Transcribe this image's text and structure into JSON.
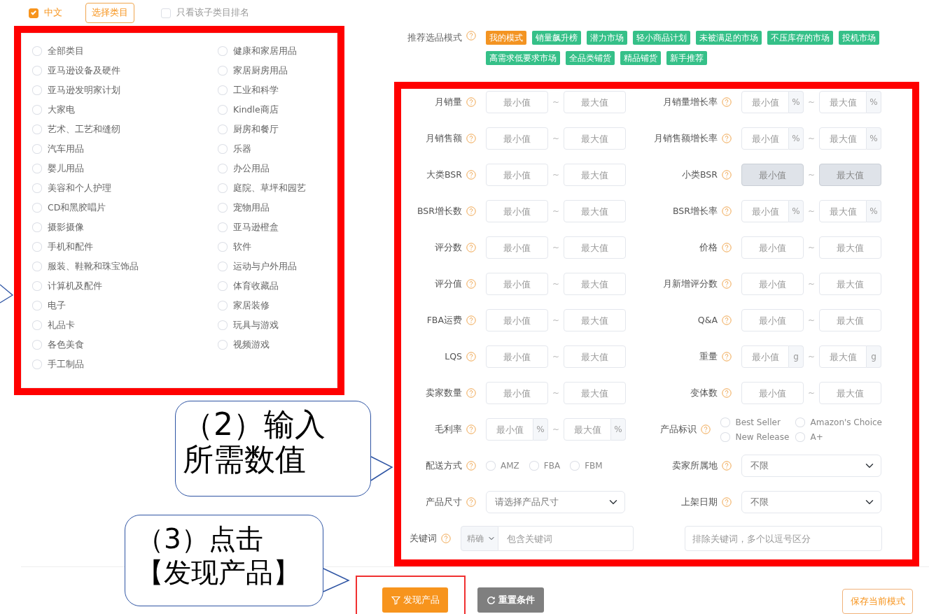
{
  "top_bar": {
    "language": {
      "label": "中文",
      "checked": true
    },
    "category_button": "选择类目",
    "subcategory_only": {
      "label": "只看该子类目排名",
      "checked": false
    }
  },
  "categories": [
    {
      "label": "全部类目",
      "checked": false
    },
    {
      "label": "亚马逊设备及硬件",
      "checked": false
    },
    {
      "label": "亚马逊发明家计划",
      "checked": false
    },
    {
      "label": "大家电",
      "checked": false
    },
    {
      "label": "艺术、工艺和缝纫",
      "checked": false
    },
    {
      "label": "汽车用品",
      "checked": false
    },
    {
      "label": "婴儿用品",
      "checked": false
    },
    {
      "label": "美容和个人护理",
      "checked": false
    },
    {
      "label": "CD和黑胶唱片",
      "checked": false
    },
    {
      "label": "摄影摄像",
      "checked": false
    },
    {
      "label": "手机和配件",
      "checked": false
    },
    {
      "label": "服装、鞋靴和珠宝饰品",
      "checked": false
    },
    {
      "label": "计算机及配件",
      "checked": false
    },
    {
      "label": "电子",
      "checked": false
    },
    {
      "label": "礼品卡",
      "checked": false
    },
    {
      "label": "各色美食",
      "checked": false
    },
    {
      "label": "手工制品",
      "checked": false
    },
    {
      "label": "健康和家居用品",
      "checked": false
    },
    {
      "label": "家居厨房用品",
      "checked": false
    },
    {
      "label": "工业和科学",
      "checked": false
    },
    {
      "label": "Kindle商店",
      "checked": false
    },
    {
      "label": "厨房和餐厅",
      "checked": false
    },
    {
      "label": "乐器",
      "checked": false
    },
    {
      "label": "办公用品",
      "checked": false
    },
    {
      "label": "庭院、草坪和园艺",
      "checked": false
    },
    {
      "label": "宠物用品",
      "checked": false
    },
    {
      "label": "亚马逊橙盒",
      "checked": false
    },
    {
      "label": "软件",
      "checked": false
    },
    {
      "label": "运动与户外用品",
      "checked": false
    },
    {
      "label": "体育收藏品",
      "checked": false
    },
    {
      "label": "家居装修",
      "checked": false
    },
    {
      "label": "玩具与游戏",
      "checked": false
    },
    {
      "label": "视频游戏",
      "checked": false
    }
  ],
  "modes": {
    "label": "推荐选品模式",
    "items": [
      {
        "label": "我的模式",
        "selected": true
      },
      {
        "label": "销量飙升榜",
        "selected": false
      },
      {
        "label": "潜力市场",
        "selected": false
      },
      {
        "label": "轻小商品计划",
        "selected": false
      },
      {
        "label": "未被满足的市场",
        "selected": false
      },
      {
        "label": "不压库存的市场",
        "selected": false
      },
      {
        "label": "投机市场",
        "selected": false
      },
      {
        "label": "高需求低要求市场",
        "selected": false
      },
      {
        "label": "全品类铺货",
        "selected": false
      },
      {
        "label": "精品铺货",
        "selected": false
      },
      {
        "label": "新手推荐",
        "selected": false
      }
    ]
  },
  "filters": [
    {
      "kind": "range",
      "label": "月销量",
      "min_placeholder": "最小值",
      "separator": "~",
      "max_placeholder": "最大值",
      "disabled": false
    },
    {
      "kind": "range",
      "label": "月销量增长率",
      "min_placeholder": "最小值",
      "min_unit": "%",
      "separator": "~",
      "max_placeholder": "最大值",
      "max_unit": "%",
      "disabled": false
    },
    {
      "kind": "range",
      "label": "月销售额",
      "min_placeholder": "最小值",
      "separator": "~",
      "max_placeholder": "最大值",
      "disabled": false
    },
    {
      "kind": "range",
      "label": "月销售额增长率",
      "min_placeholder": "最小值",
      "min_unit": "%",
      "separator": "~",
      "max_placeholder": "最大值",
      "max_unit": "%",
      "disabled": false
    },
    {
      "kind": "range",
      "label": "大类BSR",
      "min_placeholder": "最小值",
      "separator": "~",
      "max_placeholder": "最大值",
      "disabled": false
    },
    {
      "kind": "range",
      "label": "小类BSR",
      "min_placeholder": "最小值",
      "separator": "~",
      "max_placeholder": "最大值",
      "disabled": true
    },
    {
      "kind": "range",
      "label": "BSR增长数",
      "min_placeholder": "最小值",
      "separator": "~",
      "max_placeholder": "最大值",
      "disabled": false
    },
    {
      "kind": "range",
      "label": "BSR增长率",
      "min_placeholder": "最小值",
      "min_unit": "%",
      "separator": "~",
      "max_placeholder": "最大值",
      "max_unit": "%",
      "disabled": false
    },
    {
      "kind": "range",
      "label": "评分数",
      "min_placeholder": "最小值",
      "separator": "~",
      "max_placeholder": "最大值",
      "disabled": false
    },
    {
      "kind": "range",
      "label": "价格",
      "min_placeholder": "最小值",
      "separator": "~",
      "max_placeholder": "最大值",
      "disabled": false
    },
    {
      "kind": "range",
      "label": "评分值",
      "min_placeholder": "最小值",
      "separator": "~",
      "max_placeholder": "最大值",
      "disabled": false
    },
    {
      "kind": "range",
      "label": "月新增评分数",
      "min_placeholder": "最小值",
      "separator": "~",
      "max_placeholder": "最大值",
      "disabled": false
    },
    {
      "kind": "range",
      "label": "FBA运费",
      "min_placeholder": "最小值",
      "separator": "~",
      "max_placeholder": "最大值",
      "disabled": false
    },
    {
      "kind": "range",
      "label": "Q&A",
      "min_placeholder": "最小值",
      "separator": "~",
      "max_placeholder": "最大值",
      "disabled": false
    },
    {
      "kind": "range",
      "label": "LQS",
      "min_placeholder": "最小值",
      "separator": "~",
      "max_placeholder": "最大值",
      "disabled": false
    },
    {
      "kind": "range",
      "label": "重量",
      "min_placeholder": "最小值",
      "min_unit": "g",
      "separator": "~",
      "max_placeholder": "最大值",
      "max_unit": "g",
      "disabled": false
    },
    {
      "kind": "range",
      "label": "卖家数量",
      "min_placeholder": "最小值",
      "separator": "~",
      "max_placeholder": "最大值",
      "disabled": false
    },
    {
      "kind": "range",
      "label": "变体数",
      "min_placeholder": "最小值",
      "separator": "~",
      "max_placeholder": "最大值",
      "disabled": false
    },
    {
      "kind": "range",
      "label": "毛利率",
      "min_placeholder": "最小值",
      "min_unit": "%",
      "separator": "~",
      "max_placeholder": "最大值",
      "max_unit": "%",
      "disabled": false
    },
    {
      "kind": "check_grid",
      "label": "产品标识",
      "options": [
        {
          "label": "Best Seller",
          "checked": false
        },
        {
          "label": "Amazon's Choice",
          "checked": false
        },
        {
          "label": "New Release",
          "checked": false
        },
        {
          "label": "A+",
          "checked": false
        }
      ]
    },
    {
      "kind": "check_row",
      "label": "配送方式",
      "options": [
        {
          "label": "AMZ",
          "checked": false
        },
        {
          "label": "FBA",
          "checked": false
        },
        {
          "label": "FBM",
          "checked": false
        }
      ]
    },
    {
      "kind": "select",
      "label": "卖家所属地",
      "value": "不限"
    },
    {
      "kind": "select",
      "label": "产品尺寸",
      "value": "请选择产品尺寸"
    },
    {
      "kind": "select",
      "label": "上架日期",
      "value": "不限"
    },
    {
      "kind": "keyword",
      "label": "关键词",
      "match": "精确",
      "placeholder": "包含关键词"
    },
    {
      "kind": "text",
      "placeholder": "排除关键词，多个以逗号区分"
    }
  ],
  "actions": {
    "discover": "发现产品",
    "reset": "重置条件",
    "save": "保存当前模式"
  },
  "callouts": [
    {
      "lines": [
        "（2）输入",
        "所需数值"
      ]
    },
    {
      "lines": [
        "（3）点击",
        "【发现产品】"
      ]
    }
  ]
}
